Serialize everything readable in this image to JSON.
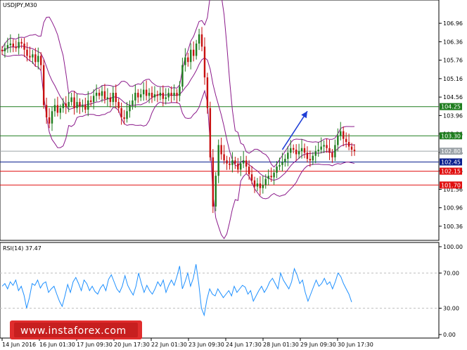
{
  "chart_data": [
    {
      "type": "candlestick",
      "title": "USDJPY,M30",
      "ylim": [
        100.06,
        107.26
      ],
      "y_ticks": [
        "106.96",
        "106.36",
        "105.76",
        "105.16",
        "104.56",
        "103.96",
        "103.36",
        "102.76",
        "102.16",
        "101.56",
        "100.96",
        "100.36"
      ],
      "x_ticks": [
        "14 Jun 2016",
        "16 Jun 01:30",
        "17 Jun 09:30",
        "20 Jun 17:30",
        "22 Jun 01:30",
        "23 Jun 09:30",
        "24 Jun 17:30",
        "28 Jun 01:30",
        "29 Jun 09:30",
        "30 Jun 17:30"
      ],
      "price_levels": [
        {
          "value": 104.25,
          "label": "104.25",
          "color": "#1e7d1e"
        },
        {
          "value": 103.3,
          "label": "103.30",
          "color": "#1e7d1e"
        },
        {
          "value": 102.8,
          "label": "102.80",
          "color": "#9ca3a8"
        },
        {
          "value": 102.45,
          "label": "102.45",
          "color": "#0a1f8f"
        },
        {
          "value": 102.15,
          "label": "102.15",
          "color": "#e01010"
        },
        {
          "value": 101.7,
          "label": "101.70",
          "color": "#e01010"
        }
      ],
      "close_series": [
        106.05,
        106.15,
        106.25,
        106.3,
        106.2,
        106.15,
        106.35,
        106.3,
        106.1,
        105.9,
        105.85,
        105.95,
        105.7,
        105.9,
        105.6,
        104.3,
        103.9,
        103.7,
        104.1,
        104.3,
        104.05,
        104.2,
        104.35,
        104.25,
        104.4,
        104.55,
        104.2,
        104.4,
        104.25,
        104.3,
        104.15,
        104.45,
        104.4,
        104.6,
        104.7,
        104.6,
        104.75,
        104.5,
        104.55,
        104.4,
        104.7,
        104.4,
        104.2,
        103.9,
        103.85,
        104.1,
        104.3,
        104.45,
        104.7,
        104.55,
        104.65,
        104.8,
        104.6,
        104.7,
        104.55,
        104.65,
        104.6,
        104.7,
        104.5,
        104.55,
        104.7,
        104.6,
        104.7,
        104.6,
        104.9,
        105.6,
        105.85,
        105.7,
        106.1,
        105.9,
        106.3,
        106.6,
        106.2,
        105.2,
        104.2,
        102.6,
        101.0,
        102.0,
        103.0,
        102.7,
        102.5,
        102.4,
        102.35,
        102.5,
        102.4,
        102.2,
        102.4,
        102.5,
        102.3,
        102.05,
        101.85,
        101.65,
        101.75,
        101.6,
        101.7,
        101.9,
        102.0,
        101.95,
        102.1,
        102.3,
        102.35,
        102.45,
        102.55,
        102.75,
        102.9,
        102.85,
        102.7,
        102.8,
        102.9,
        102.75,
        102.55,
        102.5,
        102.65,
        102.8,
        102.85,
        102.95,
        103.0,
        102.9,
        102.75,
        102.6,
        103.0,
        103.3,
        103.45,
        103.2,
        103.1,
        102.95,
        102.85,
        102.8
      ],
      "annotation": {
        "type": "arrow",
        "from": [
          101,
          102.85
        ],
        "to": [
          110,
          104.1
        ],
        "color": "#1f3fd6"
      }
    },
    {
      "type": "line",
      "title": "RSI(14) 37.47",
      "ylim": [
        0,
        100
      ],
      "y_ticks": [
        "100.00",
        "70.00",
        "30.00",
        "0.00"
      ],
      "levels": [
        70,
        30
      ],
      "values": [
        55,
        58,
        52,
        60,
        56,
        62,
        50,
        55,
        45,
        30,
        42,
        58,
        56,
        62,
        53,
        58,
        60,
        48,
        52,
        55,
        46,
        38,
        32,
        44,
        57,
        48,
        60,
        65,
        58,
        50,
        62,
        58,
        50,
        55,
        49,
        46,
        53,
        57,
        50,
        63,
        68,
        60,
        52,
        48,
        55,
        67,
        56,
        50,
        45,
        55,
        70,
        58,
        48,
        56,
        50,
        46,
        52,
        60,
        55,
        62,
        48,
        56,
        62,
        56,
        66,
        78,
        52,
        60,
        70,
        55,
        64,
        80,
        58,
        30,
        22,
        40,
        52,
        46,
        44,
        52,
        47,
        42,
        46,
        50,
        44,
        55,
        48,
        52,
        56,
        54,
        46,
        50,
        38,
        44,
        50,
        55,
        48,
        53,
        60,
        64,
        58,
        52,
        70,
        62,
        57,
        52,
        60,
        75,
        68,
        58,
        62,
        48,
        38,
        46,
        54,
        62,
        55,
        58,
        64,
        57,
        60,
        52,
        60,
        70,
        66,
        58,
        52,
        46,
        37
      ]
    }
  ],
  "watermark": "www.instaforex.com",
  "colors": {
    "bull_candle": "#1e7d1e",
    "bear_candle": "#c81010",
    "bands": "#8b1a8b",
    "rsi_line": "#1e90ff",
    "level_line_color": "#c0c0c0",
    "watermark_bg": "#e02d2d"
  }
}
